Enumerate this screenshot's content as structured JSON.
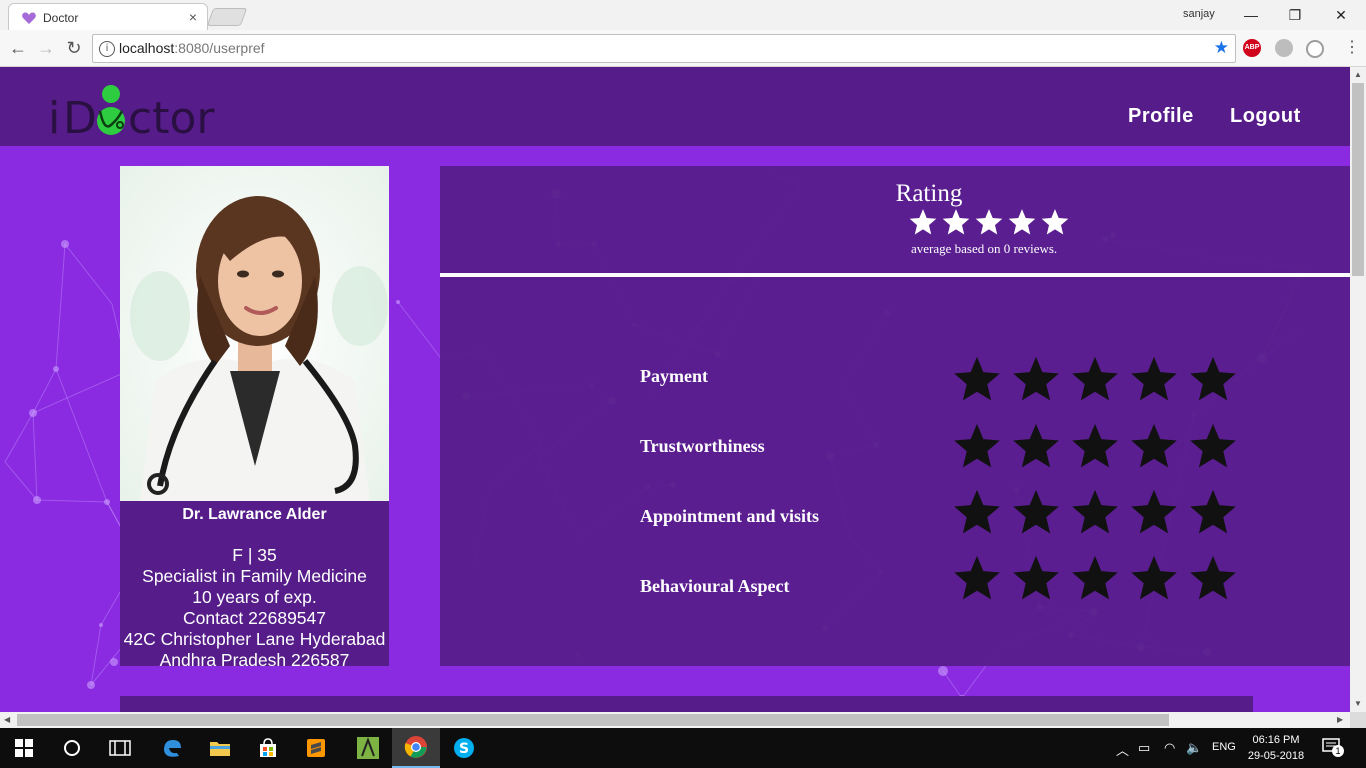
{
  "browser": {
    "tab_title": "Doctor",
    "tab_close": "×",
    "user": "sanjay",
    "window_controls": {
      "minimize": "—",
      "maximize": "❐",
      "close": "✕"
    },
    "back": "←",
    "forward": "→",
    "reload": "↻",
    "info": "i",
    "url_host": "localhost",
    "url_rest": ":8080/userpref",
    "bookmark": "★",
    "extensions": [
      "ABP",
      "",
      ""
    ],
    "menu": "⋮"
  },
  "navbar": {
    "logo": "iDoctor",
    "links": [
      "Profile",
      "Logout"
    ]
  },
  "doctor": {
    "name": "Dr. Lawrance Alder",
    "gender_age": "F | 35",
    "specialty": "Specialist in Family Medicine",
    "experience": "10 years of exp.",
    "contact": "Contact 22689547",
    "address_line1": "42C Christopher Lane Hyderabad",
    "address_line2": "Andhra Pradesh 226587"
  },
  "rating": {
    "title": "Rating",
    "average_stars": 5,
    "average_text": "average based on 0 reviews.",
    "criteria": [
      {
        "label": "Payment",
        "stars": 5,
        "filled": 0
      },
      {
        "label": "Trustworthiness",
        "stars": 5,
        "filled": 0
      },
      {
        "label": "Appointment and visits",
        "stars": 5,
        "filled": 0
      },
      {
        "label": "Behavioural Aspect",
        "stars": 5,
        "filled": 0
      }
    ]
  },
  "colors": {
    "page_bg": "#8a2be2",
    "panel_bg": "#561d8a",
    "star_empty": "#111111",
    "star_white": "#ffffff",
    "logo_green": "#2ecc40"
  },
  "taskbar": {
    "apps": [
      "start",
      "search",
      "task-view",
      "edge",
      "file-explorer",
      "store",
      "sublime-text",
      "app",
      "chrome",
      "skype"
    ],
    "active_app": "chrome",
    "language": "ENG",
    "time": "06:16 PM",
    "date": "29-05-2018",
    "notifications": "1"
  }
}
